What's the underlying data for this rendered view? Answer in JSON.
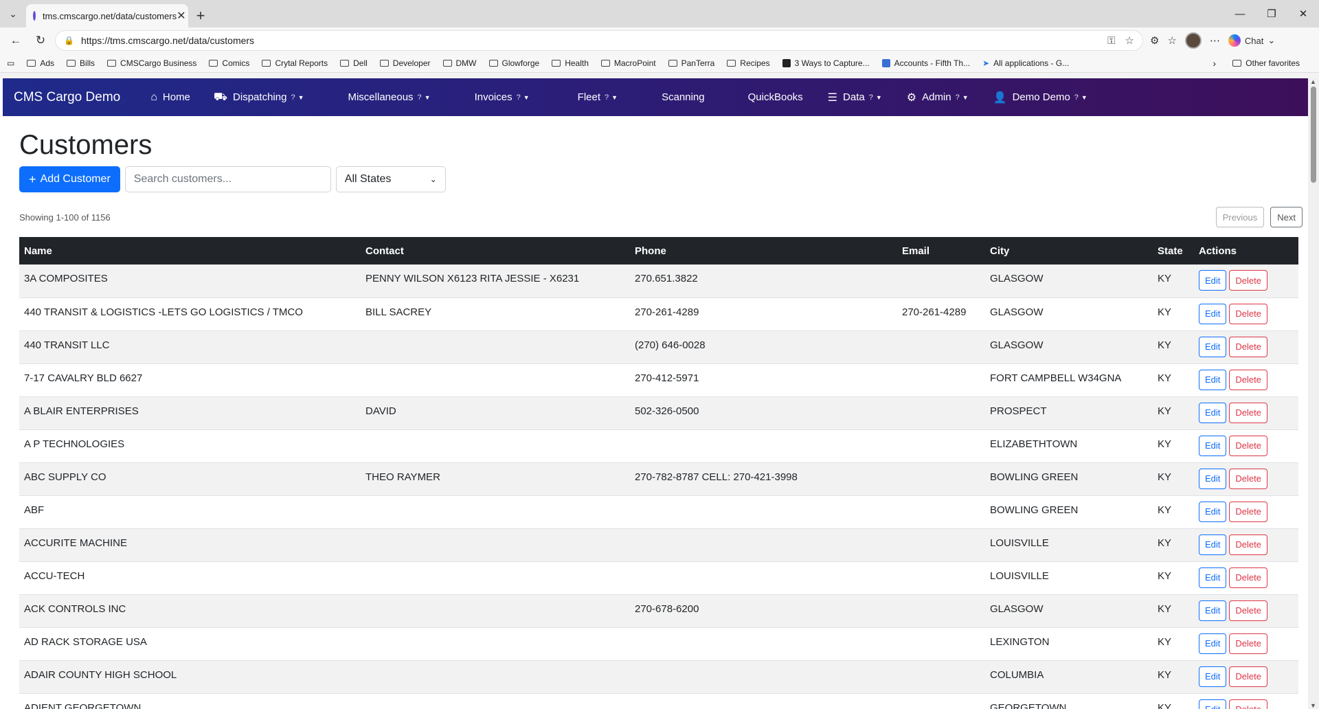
{
  "browser": {
    "tab_title": "tms.cmscargo.net/data/customers",
    "url": "https://tms.cmscargo.net/data/customers",
    "chat_label": "Chat",
    "favorites": [
      "Ads",
      "Bills",
      "CMSCargo Business",
      "Comics",
      "Crytal Reports",
      "Dell",
      "Developer",
      "DMW",
      "Glowforge",
      "Health",
      "MacroPoint",
      "PanTerra",
      "Recipes"
    ],
    "fav_capture": "3 Ways to Capture...",
    "fav_accounts": "Accounts - Fifth Th...",
    "fav_apps": "All applications - G...",
    "other_favorites": "Other favorites"
  },
  "nav": {
    "brand": "CMS Cargo Demo",
    "home": "Home",
    "dispatching": "Dispatching",
    "miscellaneous": "Miscellaneous",
    "invoices": "Invoices",
    "fleet": "Fleet",
    "scanning": "Scanning",
    "quickbooks": "QuickBooks",
    "data": "Data",
    "admin": "Admin",
    "user": "Demo Demo",
    "q": "?",
    "caret": "▼"
  },
  "page": {
    "title": "Customers",
    "add_button": "Add Customer",
    "search_placeholder": "Search customers...",
    "state_filter": "All States",
    "showing": "Showing 1-100 of 1156",
    "previous": "Previous",
    "next": "Next",
    "edit": "Edit",
    "delete": "Delete"
  },
  "table": {
    "columns": [
      "Name",
      "Contact",
      "Phone",
      "Email",
      "City",
      "State",
      "Actions"
    ],
    "rows": [
      {
        "name": "3A COMPOSITES",
        "contact": "PENNY WILSON X6123 RITA JESSIE - X6231",
        "phone": "270.651.3822",
        "email": "",
        "city": "GLASGOW",
        "state": "KY"
      },
      {
        "name": "440 TRANSIT & LOGISTICS -LETS GO LOGISTICS / TMCO",
        "contact": "BILL SACREY",
        "phone": "270-261-4289",
        "email": "270-261-4289",
        "city": "GLASGOW",
        "state": "KY"
      },
      {
        "name": "440 TRANSIT LLC",
        "contact": "",
        "phone": "(270) 646-0028",
        "email": "",
        "city": "GLASGOW",
        "state": "KY"
      },
      {
        "name": "7-17 CAVALRY BLD 6627",
        "contact": "",
        "phone": "270-412-5971",
        "email": "",
        "city": "FORT CAMPBELL W34GNA",
        "state": "KY"
      },
      {
        "name": "A BLAIR ENTERPRISES",
        "contact": "DAVID",
        "phone": "502-326-0500",
        "email": "",
        "city": "PROSPECT",
        "state": "KY"
      },
      {
        "name": "A P TECHNOLOGIES",
        "contact": "",
        "phone": "",
        "email": "",
        "city": "ELIZABETHTOWN",
        "state": "KY"
      },
      {
        "name": "ABC SUPPLY CO",
        "contact": "THEO RAYMER",
        "phone": "270-782-8787 CELL: 270-421-3998",
        "email": "",
        "city": "BOWLING GREEN",
        "state": "KY"
      },
      {
        "name": "ABF",
        "contact": "",
        "phone": "",
        "email": "",
        "city": "BOWLING GREEN",
        "state": "KY"
      },
      {
        "name": "ACCURITE MACHINE",
        "contact": "",
        "phone": "",
        "email": "",
        "city": "LOUISVILLE",
        "state": "KY"
      },
      {
        "name": "ACCU-TECH",
        "contact": "",
        "phone": "",
        "email": "",
        "city": "LOUISVILLE",
        "state": "KY"
      },
      {
        "name": "ACK CONTROLS INC",
        "contact": "",
        "phone": "270-678-6200",
        "email": "",
        "city": "GLASGOW",
        "state": "KY"
      },
      {
        "name": "AD RACK STORAGE USA",
        "contact": "",
        "phone": "",
        "email": "",
        "city": "LEXINGTON",
        "state": "KY"
      },
      {
        "name": "ADAIR COUNTY HIGH SCHOOL",
        "contact": "",
        "phone": "",
        "email": "",
        "city": "COLUMBIA",
        "state": "KY"
      },
      {
        "name": "ADIENT GEORGETOWN",
        "contact": "",
        "phone": "",
        "email": "",
        "city": "GEORGETOWN",
        "state": "KY"
      }
    ]
  }
}
